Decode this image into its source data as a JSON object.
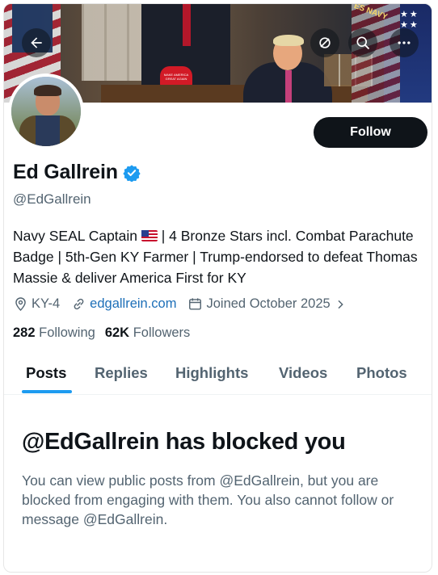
{
  "profile": {
    "name": "Ed Gallrein",
    "handle": "@EdGallrein",
    "bio_part1": "Navy SEAL Captain ",
    "bio_part2": " | 4 Bronze Stars incl. Combat Parachute Badge | 5th-Gen KY Farmer | Trump-endorsed to defeat Thomas Massie & deliver America First for KY",
    "location": "KY-4",
    "website": "edgallrein.com",
    "joined": "Joined October 2025",
    "following_count": "282",
    "following_label": "Following",
    "followers_count": "62K",
    "followers_label": "Followers"
  },
  "banner": {
    "hat_text": "MAKE AMERICA GREAT AGAIN",
    "flag_text": "ES NAVY"
  },
  "actions": {
    "follow_label": "Follow"
  },
  "tabs": [
    {
      "label": "Posts",
      "active": true
    },
    {
      "label": "Replies",
      "active": false
    },
    {
      "label": "Highlights",
      "active": false
    },
    {
      "label": "Videos",
      "active": false
    },
    {
      "label": "Photos",
      "active": false
    }
  ],
  "blocked": {
    "title": "@EdGallrein has blocked you",
    "message": "You can view public posts from @EdGallrein, but you are blocked from engaging with them. You also cannot follow or message @EdGallrein."
  },
  "icons": {
    "back": "arrow-left-icon",
    "mute": "slashed-circle-icon",
    "search": "search-icon",
    "more": "more-horizontal-icon",
    "verified": "verified-badge-icon",
    "location": "location-pin-icon",
    "link": "link-icon",
    "calendar": "calendar-icon",
    "chevron": "chevron-right-icon",
    "flag": "us-flag-icon"
  },
  "colors": {
    "accent": "#1d9bf0",
    "text": "#0f1419",
    "secondary": "#536471",
    "link": "#1d6fb8",
    "button": "#0f1419"
  }
}
